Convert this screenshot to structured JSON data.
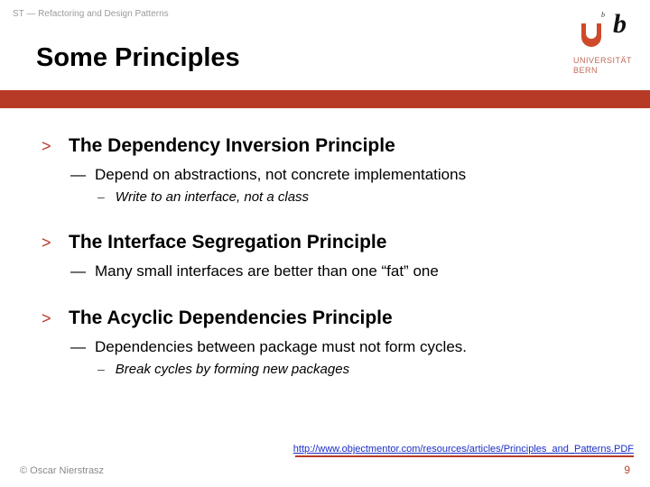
{
  "header": {
    "breadcrumb": "ST — Refactoring and Design Patterns",
    "title": "Some Principles",
    "logo": {
      "sup": "b",
      "uni_line1": "UNIVERSITÄT",
      "uni_line2": "BERN"
    }
  },
  "principles": [
    {
      "title": "The Dependency Inversion Principle",
      "sub": "Depend on abstractions, not concrete implementations",
      "note": "Write to an interface, not a class"
    },
    {
      "title": "The Interface Segregation Principle",
      "sub": "Many small interfaces are better than one “fat” one",
      "note": null
    },
    {
      "title": "The Acyclic Dependencies Principle",
      "sub": "Dependencies between package must not form cycles.",
      "note": "Break cycles by forming new packages"
    }
  ],
  "link": {
    "label": "http://www.objectmentor.com/resources/articles/Principles_and_Patterns.PDF",
    "href": "http://www.objectmentor.com/resources/articles/Principles_and_Patterns.PDF"
  },
  "footer": {
    "copyright": "© Oscar Nierstrasz",
    "page": "9"
  },
  "markers": {
    "l1": ">",
    "l2": "—",
    "l3": "–"
  }
}
